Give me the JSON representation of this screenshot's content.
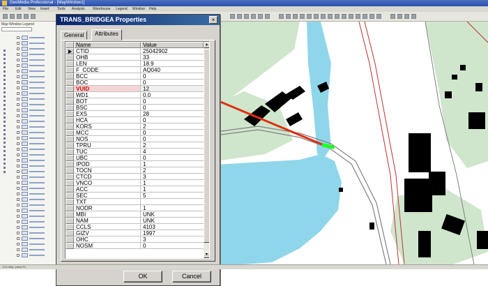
{
  "app": {
    "title": "GeoMedia Professional - [MapWindow1]",
    "menu": [
      "File",
      "Edit",
      "View",
      "Insert",
      "Tools",
      "Analysis",
      "Warehouse",
      "Legend",
      "Window",
      "Help"
    ],
    "status": "For Help, press F1"
  },
  "layers_panel": {
    "header": "Map Window Legend"
  },
  "dialog": {
    "title": "TRANS_BRIDGEA Properties",
    "close_glyph": "×",
    "tabs": [
      {
        "label": "General",
        "active": false
      },
      {
        "label": "Attributes",
        "active": true
      }
    ],
    "columns": {
      "name": "Name",
      "value": "Value"
    },
    "scroll_up": "▲",
    "scroll_down": "▼",
    "rows": [
      {
        "name": "CTID",
        "value": "25042902",
        "current": true
      },
      {
        "name": "OHB",
        "value": "33"
      },
      {
        "name": "LEN",
        "value": "18.9"
      },
      {
        "name": "F_CODE",
        "value": "AQ040"
      },
      {
        "name": "BCC",
        "value": "0"
      },
      {
        "name": "BOC",
        "value": "0"
      },
      {
        "name": "VUID",
        "value": "12",
        "highlighted": true
      },
      {
        "name": "WD1",
        "value": "0.0"
      },
      {
        "name": "BOT",
        "value": "0"
      },
      {
        "name": "BSC",
        "value": "0"
      },
      {
        "name": "EXS",
        "value": "28"
      },
      {
        "name": "HCA",
        "value": "0"
      },
      {
        "name": "KORS",
        "value": "2"
      },
      {
        "name": "MCC",
        "value": "0"
      },
      {
        "name": "NOS",
        "value": "0"
      },
      {
        "name": "TPRU",
        "value": "2"
      },
      {
        "name": "TUC",
        "value": "4"
      },
      {
        "name": "UBC",
        "value": "0"
      },
      {
        "name": "IPOD",
        "value": "1"
      },
      {
        "name": "TOCN",
        "value": "2"
      },
      {
        "name": "CTCD",
        "value": "3"
      },
      {
        "name": "VNCO",
        "value": "1"
      },
      {
        "name": "ACC",
        "value": "1"
      },
      {
        "name": "SEC",
        "value": "5"
      },
      {
        "name": "TXT",
        "value": ""
      },
      {
        "name": "NODR",
        "value": "1"
      },
      {
        "name": "MBI",
        "value": "UNK"
      },
      {
        "name": "NAM",
        "value": "UNK"
      },
      {
        "name": "CCLS",
        "value": "4103"
      },
      {
        "name": "GIZV",
        "value": "1997"
      },
      {
        "name": "OHC",
        "value": "3"
      },
      {
        "name": "NOSM",
        "value": "0"
      }
    ],
    "buttons": {
      "ok": "OK",
      "cancel": "Cancel"
    }
  },
  "colors": {
    "water": "#8fd6ea",
    "vegetation": "#cfe6cc",
    "buildings": "#000000",
    "road_edges": "#c03030",
    "annotation_arrow": "#e03010",
    "selected_bridge": "#20ff20"
  }
}
